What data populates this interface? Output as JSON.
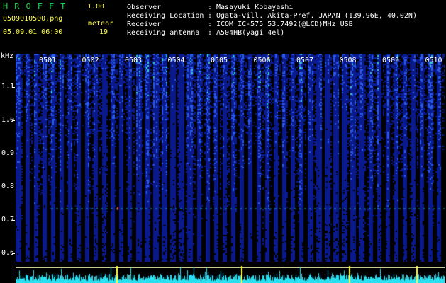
{
  "app": {
    "title_letters": [
      "H",
      "R",
      "O",
      "F",
      "F",
      "T"
    ],
    "version": "1.00",
    "filename": "0509010500.png",
    "timestamp": "05.09.01 06:00",
    "meteor_label": "meteor",
    "meteor_count": "19"
  },
  "info": {
    "labels": [
      "Observer",
      "Receiving Location",
      "Receiver",
      "Receiving antenna"
    ],
    "separator": ":",
    "values": [
      "Masayuki Kobayashi",
      "Ogata-vill. Akita-Pref. JAPAN (139.96E, 40.02N)",
      "ICOM IC-575 53.7492(@LCD)MHz USB",
      "A504HB(yagi 4el)"
    ]
  },
  "chart_data": {
    "type": "heatmap",
    "ylabel": "kHz",
    "y_ticks": [
      "1.1",
      "1.0",
      "0.9",
      "0.8",
      "0.7",
      "0.6"
    ],
    "y_values": [
      1.1,
      1.0,
      0.9,
      0.8,
      0.7,
      0.6
    ],
    "ylim": [
      0.575,
      1.2
    ],
    "x_ticks": [
      "0501",
      "0502",
      "0503",
      "0504",
      "0505",
      "0506",
      "0507",
      "0508",
      "0509",
      "0510"
    ],
    "colors": {
      "background": "#000000",
      "low": "#0a1a8c",
      "mid": "#2a5ae8",
      "high": "#3ad0d0",
      "peak": "#ffff40",
      "counts": "#29e0f0",
      "meteor_dot": "#ff4040"
    }
  }
}
